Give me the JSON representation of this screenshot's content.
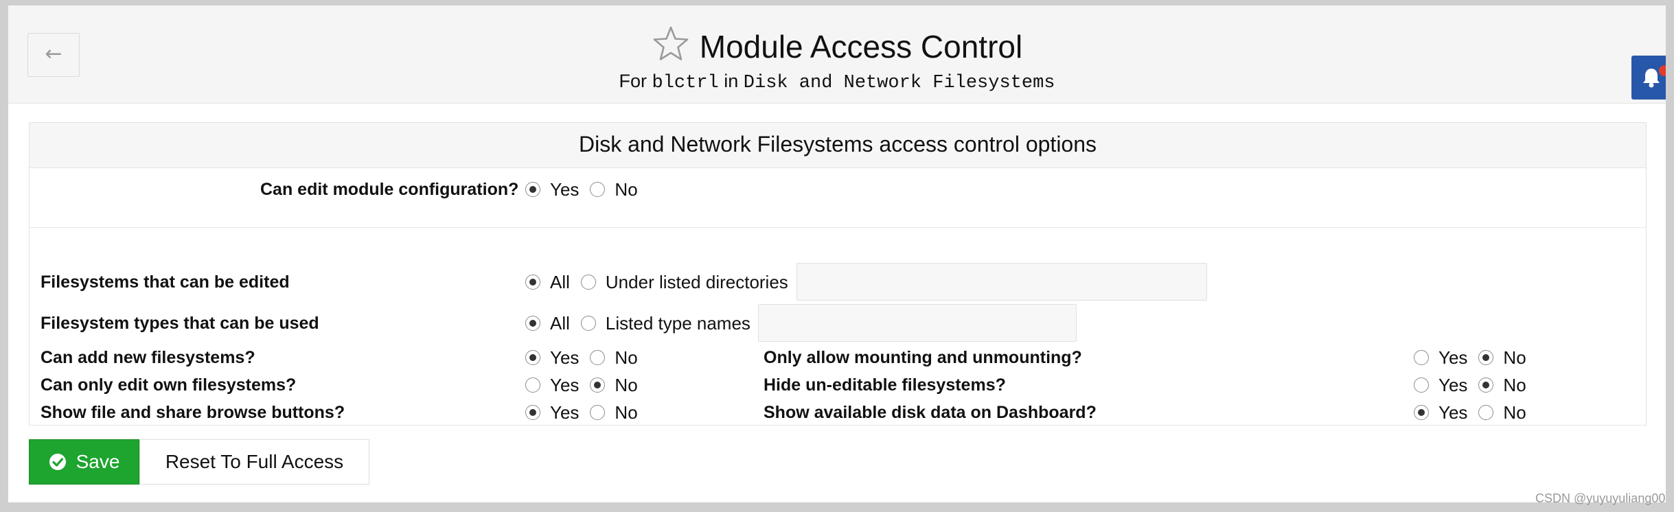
{
  "header": {
    "back_icon": "arrow-left",
    "title": "Module Access Control",
    "subtitle_prefix": "For",
    "subtitle_user": "blctrl",
    "subtitle_in": "in",
    "subtitle_module": "Disk and Network Filesystems"
  },
  "panel": {
    "title": "Disk and Network Filesystems access control options",
    "can_edit_config": {
      "label": "Can edit module configuration?",
      "yes": "Yes",
      "no": "No",
      "selected": "Yes"
    },
    "fs_edited": {
      "label": "Filesystems that can be edited",
      "opt_all": "All",
      "opt_dirs": "Under listed directories",
      "selected": "All",
      "value": ""
    },
    "fs_types": {
      "label": "Filesystem types that can be used",
      "opt_all": "All",
      "opt_listed": "Listed type names",
      "selected": "All",
      "value": ""
    },
    "can_add": {
      "label": "Can add new filesystems?",
      "yes": "Yes",
      "no": "No",
      "selected": "Yes"
    },
    "own_only": {
      "label": "Can only edit own filesystems?",
      "yes": "Yes",
      "no": "No",
      "selected": "No"
    },
    "browse_buttons": {
      "label": "Show file and share browse buttons?",
      "yes": "Yes",
      "no": "No",
      "selected": "Yes"
    },
    "mount_only": {
      "label": "Only allow mounting and unmounting?",
      "yes": "Yes",
      "no": "No",
      "selected": "No"
    },
    "hide_uneditable": {
      "label": "Hide un-editable filesystems?",
      "yes": "Yes",
      "no": "No",
      "selected": "No"
    },
    "dashboard_disk": {
      "label": "Show available disk data on Dashboard?",
      "yes": "Yes",
      "no": "No",
      "selected": "Yes"
    }
  },
  "buttons": {
    "save_label": "Save",
    "reset_label": "Reset To Full Access"
  },
  "watermark": "CSDN @yuyuyuliang00",
  "colors": {
    "save_green": "#1da52f",
    "bell_blue": "#2757a8",
    "notification_red": "#e03b2d"
  }
}
